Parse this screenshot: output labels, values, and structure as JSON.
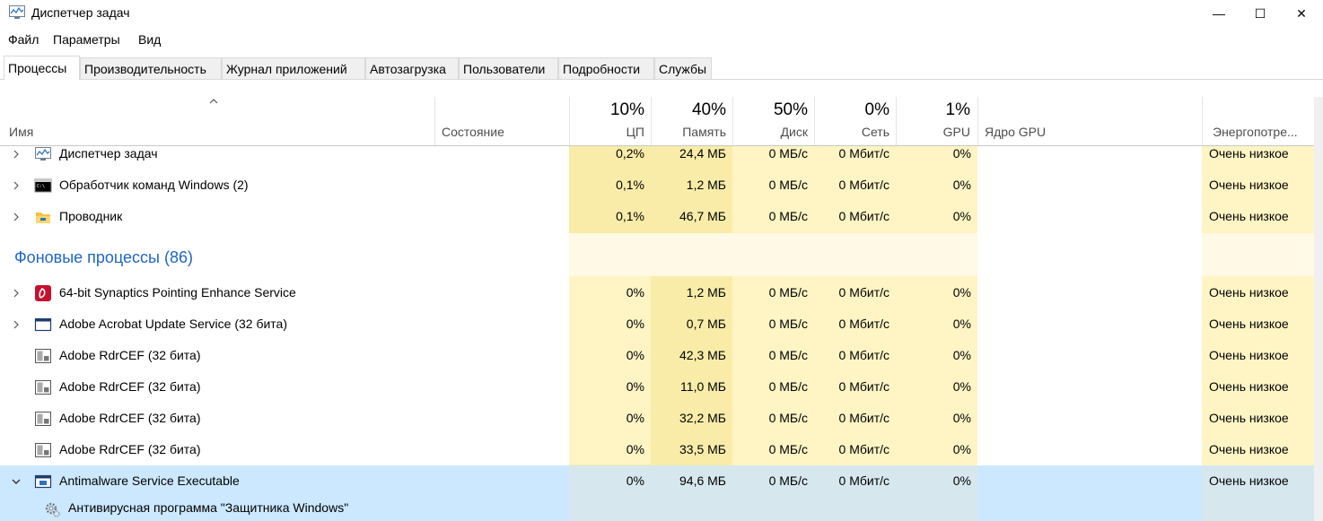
{
  "window": {
    "title": "Диспетчер задач",
    "controls": {
      "minimize": "—",
      "maximize": "☐",
      "close": "✕"
    }
  },
  "menu": [
    "Файл",
    "Параметры",
    "Вид"
  ],
  "tabs": [
    {
      "label": "Процессы",
      "active": true
    },
    {
      "label": "Производительность",
      "active": false
    },
    {
      "label": "Журнал приложений",
      "active": false
    },
    {
      "label": "Автозагрузка",
      "active": false
    },
    {
      "label": "Пользователи",
      "active": false
    },
    {
      "label": "Подробности",
      "active": false
    },
    {
      "label": "Службы",
      "active": false
    }
  ],
  "columns": {
    "name": "Имя",
    "status": "Состояние",
    "cpu": {
      "pct": "10%",
      "label": "ЦП"
    },
    "memory": {
      "pct": "40%",
      "label": "Память"
    },
    "disk": {
      "pct": "50%",
      "label": "Диск"
    },
    "network": {
      "pct": "0%",
      "label": "Сеть"
    },
    "gpu": {
      "pct": "1%",
      "label": "GPU"
    },
    "gpu_engine": "Ядро GPU",
    "power": "Энергопотре..."
  },
  "apps": [
    {
      "name": "Диспетчер задач",
      "icon": "task-manager-icon",
      "cpu": "0,2%",
      "mem": "24,4 МБ",
      "disk": "0 МБ/с",
      "net": "0 Мбит/с",
      "gpu": "0%",
      "power": "Очень низкое"
    },
    {
      "name": "Обработчик команд Windows (2)",
      "icon": "cmd-icon",
      "cpu": "0,1%",
      "mem": "1,2 МБ",
      "disk": "0 МБ/с",
      "net": "0 Мбит/с",
      "gpu": "0%",
      "power": "Очень низкое"
    },
    {
      "name": "Проводник",
      "icon": "explorer-folder-icon",
      "cpu": "0,1%",
      "mem": "46,7 МБ",
      "disk": "0 МБ/с",
      "net": "0 Мбит/с",
      "gpu": "0%",
      "power": "Очень низкое"
    }
  ],
  "background_group": "Фоновые процессы (86)",
  "background": [
    {
      "name": "64-bit Synaptics Pointing Enhance Service",
      "icon": "synaptics-icon",
      "expand": true,
      "cpu": "0%",
      "mem": "1,2 МБ",
      "disk": "0 МБ/с",
      "net": "0 Мбит/с",
      "gpu": "0%",
      "power": "Очень низкое"
    },
    {
      "name": "Adobe Acrobat Update Service (32 бита)",
      "icon": "service-window-icon",
      "expand": true,
      "cpu": "0%",
      "mem": "0,7 МБ",
      "disk": "0 МБ/с",
      "net": "0 Мбит/с",
      "gpu": "0%",
      "power": "Очень низкое"
    },
    {
      "name": "Adobe RdrCEF (32 бита)",
      "icon": "app-generic-icon",
      "expand": false,
      "cpu": "0%",
      "mem": "42,3 МБ",
      "disk": "0 МБ/с",
      "net": "0 Мбит/с",
      "gpu": "0%",
      "power": "Очень низкое"
    },
    {
      "name": "Adobe RdrCEF (32 бита)",
      "icon": "app-generic-icon",
      "expand": false,
      "cpu": "0%",
      "mem": "11,0 МБ",
      "disk": "0 МБ/с",
      "net": "0 Мбит/с",
      "gpu": "0%",
      "power": "Очень низкое"
    },
    {
      "name": "Adobe RdrCEF (32 бита)",
      "icon": "app-generic-icon",
      "expand": false,
      "cpu": "0%",
      "mem": "32,2 МБ",
      "disk": "0 МБ/с",
      "net": "0 Мбит/с",
      "gpu": "0%",
      "power": "Очень низкое"
    },
    {
      "name": "Adobe RdrCEF (32 бита)",
      "icon": "app-generic-icon",
      "expand": false,
      "cpu": "0%",
      "mem": "33,5 МБ",
      "disk": "0 МБ/с",
      "net": "0 Мбит/с",
      "gpu": "0%",
      "power": "Очень низкое"
    },
    {
      "name": "Antimalware Service Executable",
      "icon": "service-app-icon",
      "expanded": true,
      "cpu": "0%",
      "mem": "94,6 МБ",
      "disk": "0 МБ/с",
      "net": "0 Мбит/с",
      "gpu": "0%",
      "power": "Очень низкое"
    }
  ],
  "child_service": "Антивирусная программа \"Защитника Windows\"",
  "colors": {
    "heat_light": "#fff4c4",
    "heat_medium": "#f9eca8",
    "heat_group": "#fff9e5",
    "selected": "#cce8ff",
    "group_text": "#1e66c3"
  }
}
